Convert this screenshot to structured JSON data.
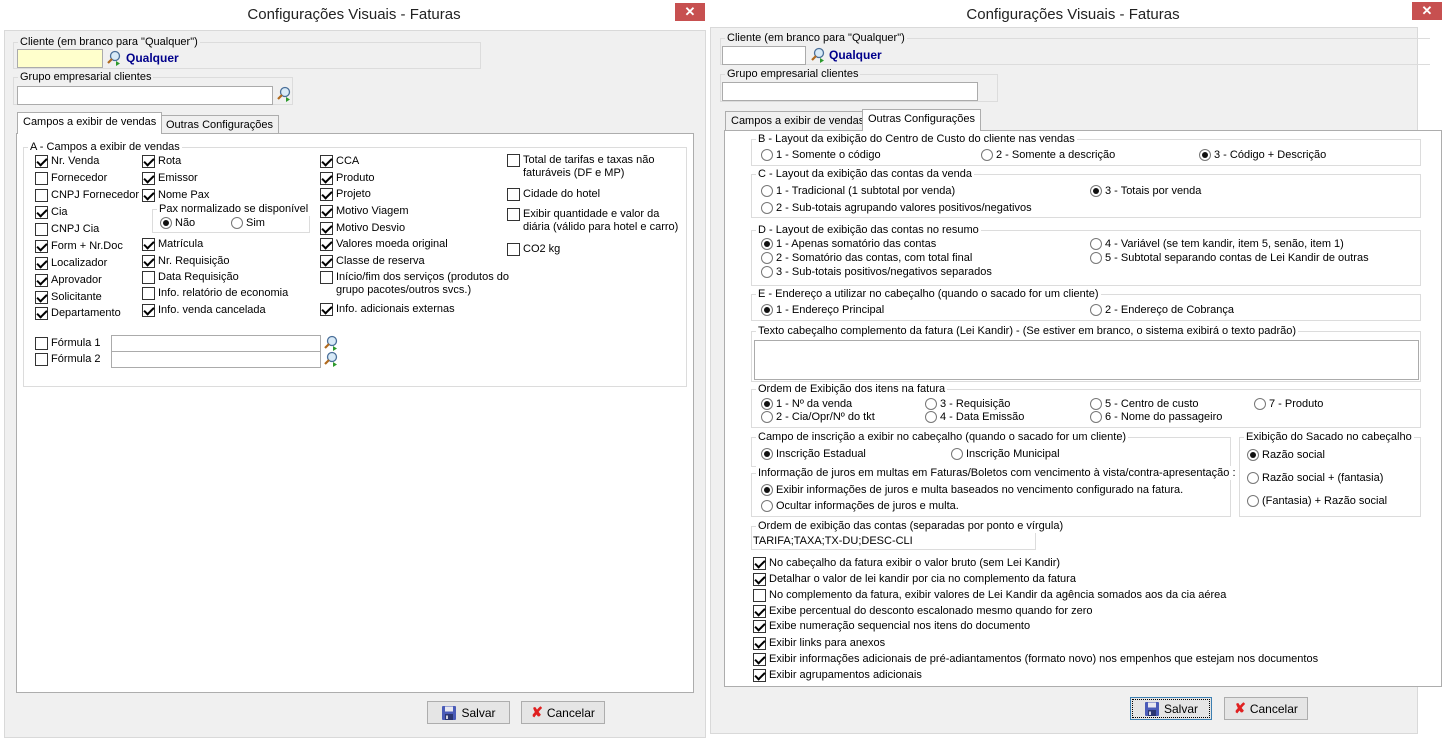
{
  "left": {
    "title": "Configurações Visuais - Faturas",
    "close_label": "✕",
    "cliente": {
      "legend": "Cliente (em branco para \"Qualquer\")",
      "value": "",
      "resolved": "Qualquer"
    },
    "grupo": {
      "legend": "Grupo empresarial clientes",
      "value": ""
    },
    "tabs": [
      {
        "label": "Campos a exibir de vendas",
        "active": true
      },
      {
        "label": "Outras Configurações",
        "active": false
      }
    ],
    "groupA": {
      "legend": "A - Campos a exibir de vendas",
      "col1": [
        {
          "label": "Nr. Venda",
          "checked": true
        },
        {
          "label": "Fornecedor",
          "checked": false
        },
        {
          "label": "CNPJ Fornecedor",
          "checked": false
        },
        {
          "label": "Cia",
          "checked": true
        },
        {
          "label": "CNPJ Cia",
          "checked": false
        },
        {
          "label": "Form + Nr.Doc",
          "checked": true
        },
        {
          "label": "Localizador",
          "checked": true
        },
        {
          "label": "Aprovador",
          "checked": true
        },
        {
          "label": "Solicitante",
          "checked": true
        },
        {
          "label": "Departamento",
          "checked": true
        }
      ],
      "col2_top": [
        {
          "label": "Rota",
          "checked": true
        },
        {
          "label": "Emissor",
          "checked": true
        },
        {
          "label": "Nome Pax",
          "checked": true
        }
      ],
      "pax": {
        "legend": "Pax normalizado se disponível",
        "options": [
          {
            "label": "Não",
            "selected": true
          },
          {
            "label": "Sim",
            "selected": false
          }
        ]
      },
      "col2_bottom": [
        {
          "label": "Matrícula",
          "checked": true
        },
        {
          "label": "Nr. Requisição",
          "checked": true
        },
        {
          "label": "Data Requisição",
          "checked": false
        },
        {
          "label": "Info. relatório de economia",
          "checked": false
        },
        {
          "label": "Info. venda cancelada",
          "checked": true
        }
      ],
      "col3": [
        {
          "label": "CCA",
          "checked": true
        },
        {
          "label": "Produto",
          "checked": true
        },
        {
          "label": "Projeto",
          "checked": true
        },
        {
          "label": "Motivo Viagem",
          "checked": true
        },
        {
          "label": "Motivo Desvio",
          "checked": true
        },
        {
          "label": "Valores moeda original",
          "checked": true
        },
        {
          "label": "Classe de reserva",
          "checked": true
        },
        {
          "label": "Início/fim dos serviços (produtos do grupo pacotes/outros svcs.)",
          "checked": false
        },
        {
          "label": "Info. adicionais externas",
          "checked": true
        }
      ],
      "col4": [
        {
          "label": "Total de tarifas e taxas não faturáveis (DF e MP)",
          "checked": false
        },
        {
          "label": "Cidade do hotel",
          "checked": false
        },
        {
          "label": "Exibir quantidade e valor da diária (válido para hotel e carro)",
          "checked": false
        },
        {
          "label": "CO2 kg",
          "checked": false
        }
      ],
      "formulas": [
        {
          "label": "Fórmula 1",
          "checked": false,
          "value": ""
        },
        {
          "label": "Fórmula 2",
          "checked": false,
          "value": ""
        }
      ]
    },
    "buttons": {
      "save": "Salvar",
      "cancel": "Cancelar"
    }
  },
  "right": {
    "title": "Configurações Visuais - Faturas",
    "close_label": "✕",
    "cliente": {
      "legend": "Cliente (em branco para \"Qualquer\")",
      "value": "",
      "resolved": "Qualquer"
    },
    "grupo": {
      "legend": "Grupo empresarial clientes",
      "value": ""
    },
    "tabs": [
      {
        "label": "Campos a exibir de vendas",
        "active": false
      },
      {
        "label": "Outras Configurações",
        "active": true
      }
    ],
    "groupB": {
      "legend": "B - Layout da exibição do Centro de Custo do cliente nas vendas",
      "options": [
        {
          "label": "1 - Somente o código",
          "selected": false
        },
        {
          "label": "2 - Somente a descrição",
          "selected": false
        },
        {
          "label": "3 - Código + Descrição",
          "selected": true
        }
      ]
    },
    "groupC": {
      "legend": "C - Layout da exibição das contas da venda",
      "options": [
        {
          "label": "1 - Tradicional (1 subtotal por venda)",
          "selected": false
        },
        {
          "label": "3 - Totais por venda",
          "selected": true
        },
        {
          "label": "2 - Sub-totais agrupando valores positivos/negativos",
          "selected": false
        }
      ]
    },
    "groupD": {
      "legend": "D - Layout de exibição das contas no resumo",
      "options": [
        {
          "label": "1 - Apenas somatório das contas",
          "selected": true
        },
        {
          "label": "4 - Variável (se tem kandir, item 5, senão, item 1)",
          "selected": false
        },
        {
          "label": "2 - Somatório das contas, com total final",
          "selected": false
        },
        {
          "label": "5 - Subtotal separando contas de Lei Kandir de outras",
          "selected": false
        },
        {
          "label": "3 - Sub-totais positivos/negativos separados",
          "selected": false
        }
      ]
    },
    "groupE": {
      "legend": "E - Endereço a utilizar no cabeçalho (quando o sacado for um cliente)",
      "options": [
        {
          "label": "1 - Endereço Principal",
          "selected": true
        },
        {
          "label": "2 - Endereço de Cobrança",
          "selected": false
        }
      ]
    },
    "texto": {
      "legend": "Texto cabeçalho complemento da fatura (Lei Kandir) - (Se estiver em branco, o sistema exibirá o texto padrão)",
      "value": ""
    },
    "ordem": {
      "legend": "Ordem de Exibição dos itens na fatura",
      "options": [
        {
          "label": "1 - Nº da venda",
          "selected": true
        },
        {
          "label": "3 - Requisição",
          "selected": false
        },
        {
          "label": "5 - Centro de custo",
          "selected": false
        },
        {
          "label": "7 - Produto",
          "selected": false
        },
        {
          "label": "2 - Cia/Opr/Nº do tkt",
          "selected": false
        },
        {
          "label": "4 - Data Emissão",
          "selected": false
        },
        {
          "label": "6 - Nome do passageiro",
          "selected": false
        }
      ]
    },
    "inscricao": {
      "legend": "Campo de inscrição a exibir no cabeçalho (quando o sacado for um cliente)",
      "options": [
        {
          "label": "Inscrição Estadual",
          "selected": true
        },
        {
          "label": "Inscrição Municipal",
          "selected": false
        }
      ]
    },
    "sacado": {
      "legend": "Exibição do Sacado no cabeçalho",
      "options": [
        {
          "label": "Razão social",
          "selected": true
        },
        {
          "label": "Razão social + (fantasia)",
          "selected": false
        },
        {
          "label": "(Fantasia) + Razão social",
          "selected": false
        }
      ]
    },
    "juros": {
      "legend": "Informação de juros em multas em Faturas/Boletos com vencimento à vista/contra-apresentação :",
      "options": [
        {
          "label": "Exibir informações de juros e multa baseados no vencimento configurado na fatura.",
          "selected": true
        },
        {
          "label": "Ocultar informações de juros e multa.",
          "selected": false
        }
      ]
    },
    "ordemContas": {
      "legend": "Ordem de exibição das contas (separadas por ponto e vírgula)",
      "value": "TARIFA;TAXA;TX-DU;DESC-CLI"
    },
    "checks": [
      {
        "label": "No cabeçalho da fatura exibir o valor bruto (sem Lei Kandir)",
        "checked": true
      },
      {
        "label": "Detalhar o valor de lei kandir por cia no complemento da fatura",
        "checked": true
      },
      {
        "label": "No complemento da fatura, exibir valores de Lei Kandir da agência somados aos da cia aérea",
        "checked": false
      },
      {
        "label": "Exibe percentual do desconto escalonado mesmo quando for zero",
        "checked": true
      },
      {
        "label": "Exibe numeração sequencial nos itens do documento",
        "checked": true
      },
      {
        "label": "Exibir links para anexos",
        "checked": true
      },
      {
        "label": "Exibir informações adicionais de pré-adiantamentos (formato novo) nos empenhos que estejam nos documentos",
        "checked": true
      },
      {
        "label": "Exibir agrupamentos adicionais",
        "checked": true
      }
    ],
    "buttons": {
      "save": "Salvar",
      "cancel": "Cancelar"
    }
  }
}
